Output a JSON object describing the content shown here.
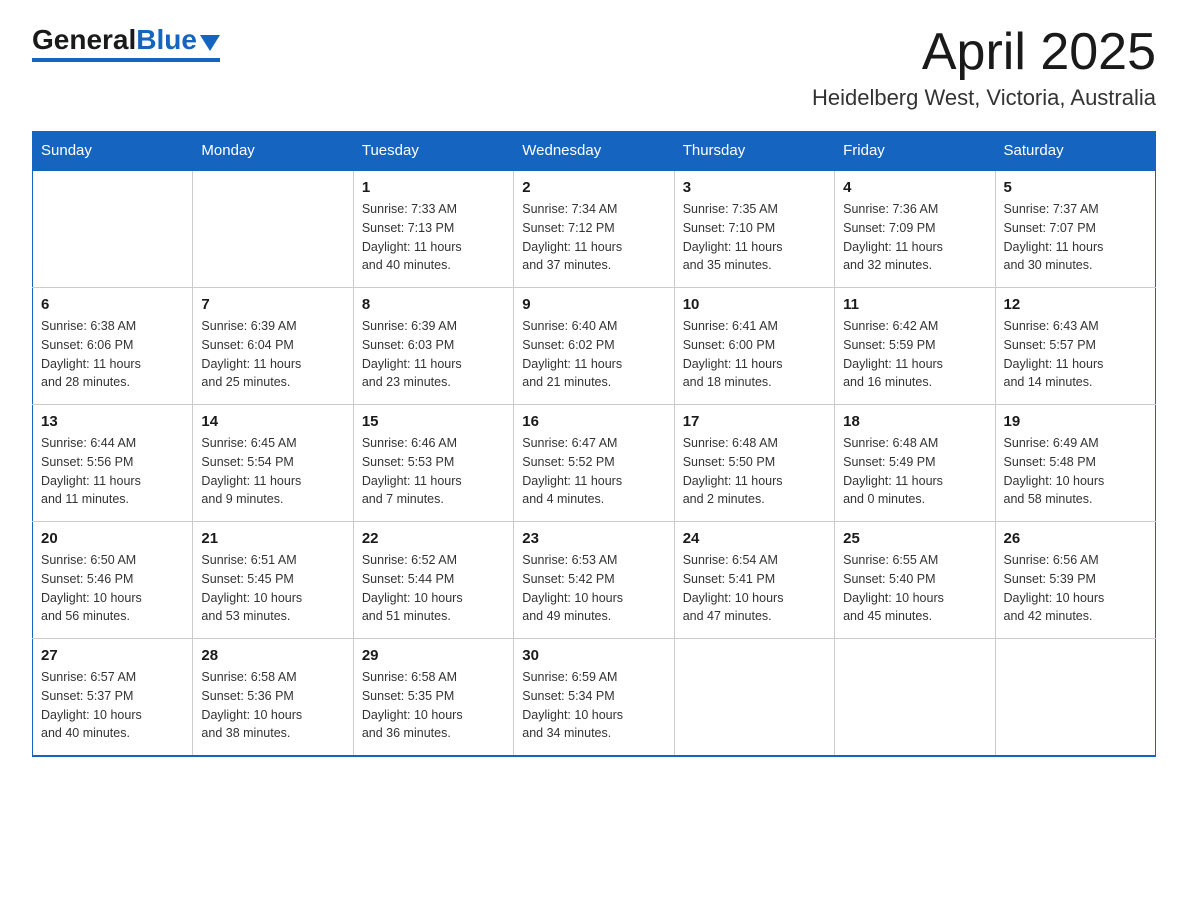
{
  "header": {
    "logo_general": "General",
    "logo_blue": "Blue",
    "month_title": "April 2025",
    "location": "Heidelberg West, Victoria, Australia"
  },
  "days_of_week": [
    "Sunday",
    "Monday",
    "Tuesday",
    "Wednesday",
    "Thursday",
    "Friday",
    "Saturday"
  ],
  "weeks": [
    [
      {
        "day": "",
        "info": ""
      },
      {
        "day": "",
        "info": ""
      },
      {
        "day": "1",
        "info": "Sunrise: 7:33 AM\nSunset: 7:13 PM\nDaylight: 11 hours\nand 40 minutes."
      },
      {
        "day": "2",
        "info": "Sunrise: 7:34 AM\nSunset: 7:12 PM\nDaylight: 11 hours\nand 37 minutes."
      },
      {
        "day": "3",
        "info": "Sunrise: 7:35 AM\nSunset: 7:10 PM\nDaylight: 11 hours\nand 35 minutes."
      },
      {
        "day": "4",
        "info": "Sunrise: 7:36 AM\nSunset: 7:09 PM\nDaylight: 11 hours\nand 32 minutes."
      },
      {
        "day": "5",
        "info": "Sunrise: 7:37 AM\nSunset: 7:07 PM\nDaylight: 11 hours\nand 30 minutes."
      }
    ],
    [
      {
        "day": "6",
        "info": "Sunrise: 6:38 AM\nSunset: 6:06 PM\nDaylight: 11 hours\nand 28 minutes."
      },
      {
        "day": "7",
        "info": "Sunrise: 6:39 AM\nSunset: 6:04 PM\nDaylight: 11 hours\nand 25 minutes."
      },
      {
        "day": "8",
        "info": "Sunrise: 6:39 AM\nSunset: 6:03 PM\nDaylight: 11 hours\nand 23 minutes."
      },
      {
        "day": "9",
        "info": "Sunrise: 6:40 AM\nSunset: 6:02 PM\nDaylight: 11 hours\nand 21 minutes."
      },
      {
        "day": "10",
        "info": "Sunrise: 6:41 AM\nSunset: 6:00 PM\nDaylight: 11 hours\nand 18 minutes."
      },
      {
        "day": "11",
        "info": "Sunrise: 6:42 AM\nSunset: 5:59 PM\nDaylight: 11 hours\nand 16 minutes."
      },
      {
        "day": "12",
        "info": "Sunrise: 6:43 AM\nSunset: 5:57 PM\nDaylight: 11 hours\nand 14 minutes."
      }
    ],
    [
      {
        "day": "13",
        "info": "Sunrise: 6:44 AM\nSunset: 5:56 PM\nDaylight: 11 hours\nand 11 minutes."
      },
      {
        "day": "14",
        "info": "Sunrise: 6:45 AM\nSunset: 5:54 PM\nDaylight: 11 hours\nand 9 minutes."
      },
      {
        "day": "15",
        "info": "Sunrise: 6:46 AM\nSunset: 5:53 PM\nDaylight: 11 hours\nand 7 minutes."
      },
      {
        "day": "16",
        "info": "Sunrise: 6:47 AM\nSunset: 5:52 PM\nDaylight: 11 hours\nand 4 minutes."
      },
      {
        "day": "17",
        "info": "Sunrise: 6:48 AM\nSunset: 5:50 PM\nDaylight: 11 hours\nand 2 minutes."
      },
      {
        "day": "18",
        "info": "Sunrise: 6:48 AM\nSunset: 5:49 PM\nDaylight: 11 hours\nand 0 minutes."
      },
      {
        "day": "19",
        "info": "Sunrise: 6:49 AM\nSunset: 5:48 PM\nDaylight: 10 hours\nand 58 minutes."
      }
    ],
    [
      {
        "day": "20",
        "info": "Sunrise: 6:50 AM\nSunset: 5:46 PM\nDaylight: 10 hours\nand 56 minutes."
      },
      {
        "day": "21",
        "info": "Sunrise: 6:51 AM\nSunset: 5:45 PM\nDaylight: 10 hours\nand 53 minutes."
      },
      {
        "day": "22",
        "info": "Sunrise: 6:52 AM\nSunset: 5:44 PM\nDaylight: 10 hours\nand 51 minutes."
      },
      {
        "day": "23",
        "info": "Sunrise: 6:53 AM\nSunset: 5:42 PM\nDaylight: 10 hours\nand 49 minutes."
      },
      {
        "day": "24",
        "info": "Sunrise: 6:54 AM\nSunset: 5:41 PM\nDaylight: 10 hours\nand 47 minutes."
      },
      {
        "day": "25",
        "info": "Sunrise: 6:55 AM\nSunset: 5:40 PM\nDaylight: 10 hours\nand 45 minutes."
      },
      {
        "day": "26",
        "info": "Sunrise: 6:56 AM\nSunset: 5:39 PM\nDaylight: 10 hours\nand 42 minutes."
      }
    ],
    [
      {
        "day": "27",
        "info": "Sunrise: 6:57 AM\nSunset: 5:37 PM\nDaylight: 10 hours\nand 40 minutes."
      },
      {
        "day": "28",
        "info": "Sunrise: 6:58 AM\nSunset: 5:36 PM\nDaylight: 10 hours\nand 38 minutes."
      },
      {
        "day": "29",
        "info": "Sunrise: 6:58 AM\nSunset: 5:35 PM\nDaylight: 10 hours\nand 36 minutes."
      },
      {
        "day": "30",
        "info": "Sunrise: 6:59 AM\nSunset: 5:34 PM\nDaylight: 10 hours\nand 34 minutes."
      },
      {
        "day": "",
        "info": ""
      },
      {
        "day": "",
        "info": ""
      },
      {
        "day": "",
        "info": ""
      }
    ]
  ]
}
